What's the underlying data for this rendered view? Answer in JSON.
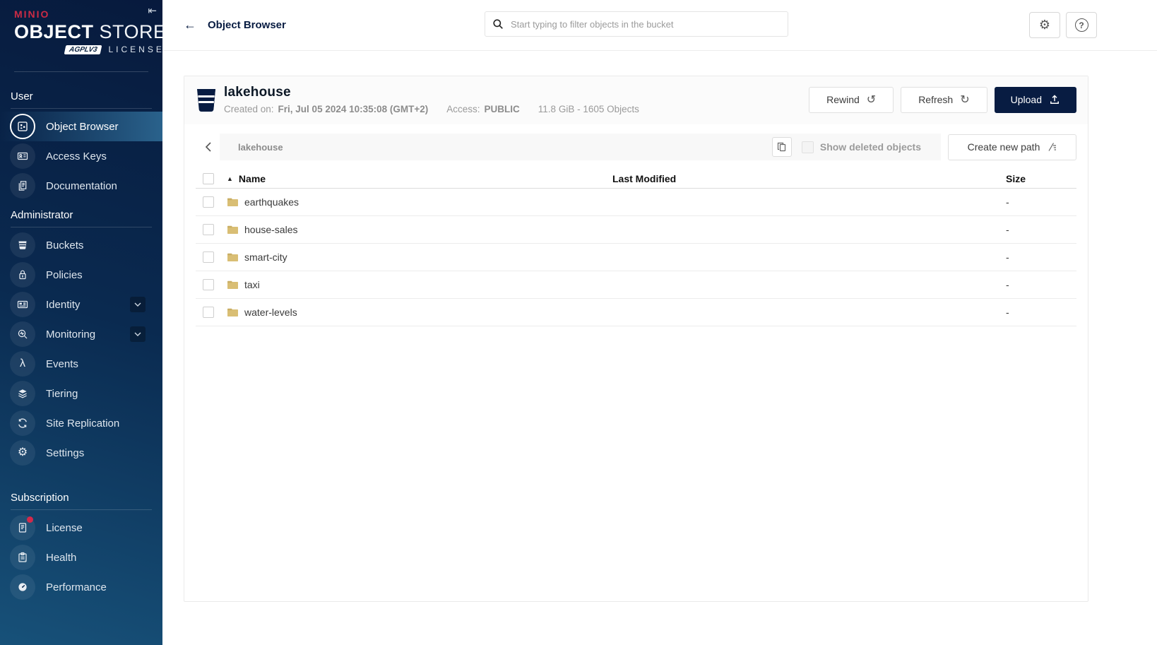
{
  "colors": {
    "accent_navy": "#081C42",
    "brand_red": "#CB2B45",
    "sidebar_top": "#071A3D",
    "sidebar_bottom": "#175179",
    "active_item_highlight": "#2A628C",
    "folder_fill": "#D9BE74",
    "folder_tab": "#C9AE64",
    "notification_red": "#D3294B"
  },
  "icons": {
    "collapse": "⇤",
    "back": "←",
    "rewind": "↺",
    "refresh": "↻",
    "gear": "⚙",
    "help": "?",
    "lambda": "λ",
    "settings_gear": "⚙",
    "sort_asc": "▲"
  },
  "sidebar": {
    "logo": {
      "brand": "MINIO",
      "title_bold": "OBJECT",
      "title_light": "STORE",
      "badge": "AGPLV3",
      "license_label": "LICENSE"
    },
    "sections": [
      {
        "label": "User",
        "items": [
          {
            "label": "Object Browser",
            "icon": "object-browser-icon",
            "active": true
          },
          {
            "label": "Access Keys",
            "icon": "access-keys-icon"
          },
          {
            "label": "Documentation",
            "icon": "documentation-icon"
          }
        ]
      },
      {
        "label": "Administrator",
        "items": [
          {
            "label": "Buckets",
            "icon": "buckets-icon"
          },
          {
            "label": "Policies",
            "icon": "policies-icon"
          },
          {
            "label": "Identity",
            "icon": "identity-icon",
            "expandable": true
          },
          {
            "label": "Monitoring",
            "icon": "monitoring-icon",
            "expandable": true
          },
          {
            "label": "Events",
            "icon": "events-icon"
          },
          {
            "label": "Tiering",
            "icon": "tiering-icon"
          },
          {
            "label": "Site Replication",
            "icon": "site-replication-icon"
          },
          {
            "label": "Settings",
            "icon": "settings-icon"
          }
        ]
      },
      {
        "label": "Subscription",
        "items": [
          {
            "label": "License",
            "icon": "license-icon",
            "notification": true
          },
          {
            "label": "Health",
            "icon": "health-icon"
          },
          {
            "label": "Performance",
            "icon": "performance-icon"
          }
        ]
      }
    ]
  },
  "header": {
    "title": "Object Browser",
    "search_placeholder": "Start typing to filter objects in the bucket"
  },
  "bucket": {
    "name": "lakehouse",
    "created_label": "Created on:",
    "created_value": "Fri, Jul 05 2024 10:35:08 (GMT+2)",
    "access_label": "Access:",
    "access_value": "PUBLIC",
    "stats": "11.8 GiB - 1605 Objects",
    "rewind_label": "Rewind",
    "refresh_label": "Refresh",
    "upload_label": "Upload"
  },
  "pathbar": {
    "current_path": "lakehouse",
    "show_deleted_label": "Show deleted objects",
    "create_path_label": "Create new path"
  },
  "table": {
    "columns": {
      "name": "Name",
      "last_modified": "Last Modified",
      "size": "Size"
    },
    "rows": [
      {
        "name": "earthquakes",
        "last_modified": "",
        "size": "-"
      },
      {
        "name": "house-sales",
        "last_modified": "",
        "size": "-"
      },
      {
        "name": "smart-city",
        "last_modified": "",
        "size": "-"
      },
      {
        "name": "taxi",
        "last_modified": "",
        "size": "-"
      },
      {
        "name": "water-levels",
        "last_modified": "",
        "size": "-"
      }
    ]
  }
}
